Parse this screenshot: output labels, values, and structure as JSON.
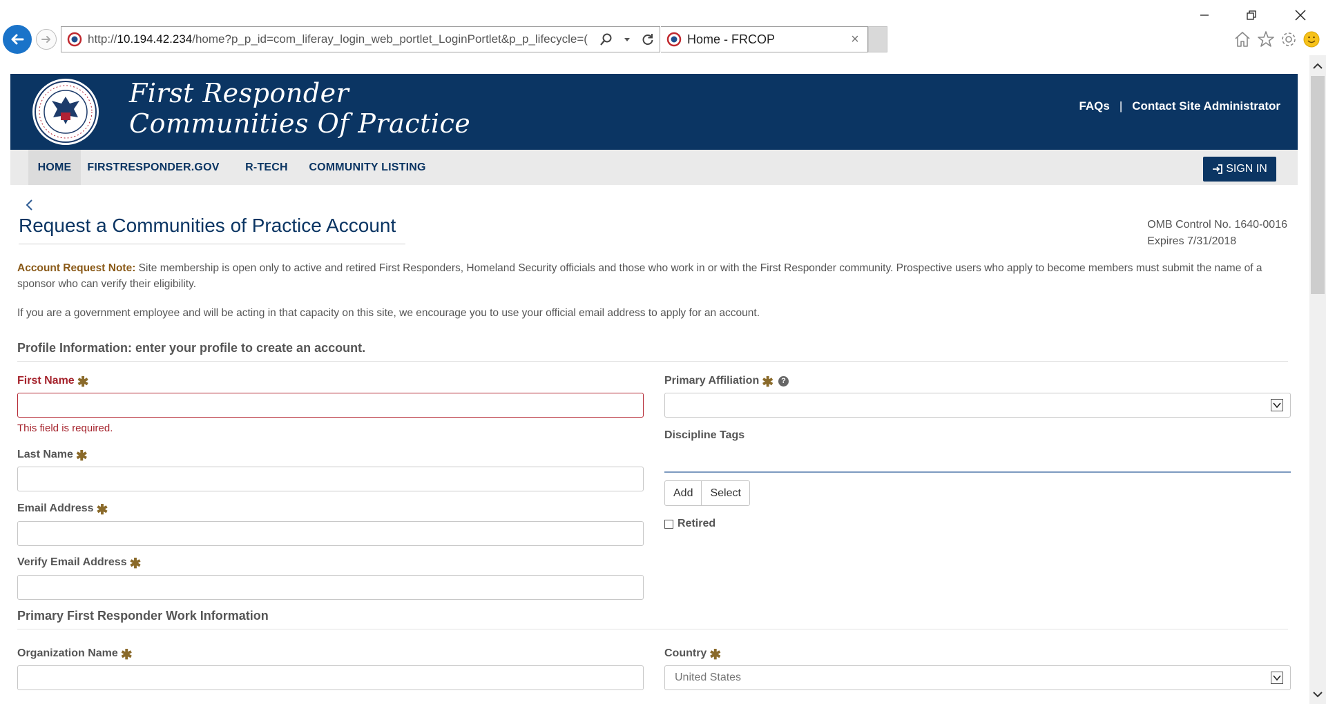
{
  "browser": {
    "url_scheme": "http://",
    "url_host": "10.194.42.234",
    "url_path": "/home?p_p_id=com_liferay_login_web_portlet_LoginPortlet&p_p_lifecycle=(",
    "tab_title": "Home - FRCOP",
    "tab_close": "×"
  },
  "header": {
    "title_line1": "First Responder",
    "title_line2": "Communities Of Practice",
    "faqs": "FAQs",
    "separator": "|",
    "contact": "Contact Site Administrator"
  },
  "nav": {
    "items": [
      {
        "label": "HOME"
      },
      {
        "label": "FIRSTRESPONDER.GOV"
      },
      {
        "label": "R-TECH"
      },
      {
        "label": "COMMUNITY LISTING"
      }
    ],
    "signin": "SIGN IN"
  },
  "page": {
    "title": "Request a Communities of Practice Account",
    "omb_line1": "OMB Control No. 1640-0016",
    "omb_line2": "Expires 7/31/2018",
    "note_label": "Account Request Note:",
    "note_text": " Site membership is open only to active and retired First Responders, Homeland Security officials and those who work in or with the First Responder community. Prospective users who apply to become members must submit the name of a sponsor who can verify their eligibility.",
    "gov_note": "If you are a government employee and will be acting in that capacity on this site, we encourage you to use your official email address to apply for an account."
  },
  "profile": {
    "section_title": "Profile Information: enter your profile to create an account.",
    "first_name_label": "First Name",
    "first_name_error": "This field is required.",
    "last_name_label": "Last Name",
    "email_label": "Email Address",
    "verify_email_label": "Verify Email Address",
    "primary_affiliation_label": "Primary Affiliation",
    "primary_affiliation_value": "",
    "discipline_tags_label": "Discipline Tags",
    "add_label": "Add",
    "select_label": "Select",
    "retired_label": "Retired"
  },
  "work": {
    "section_title": "Primary First Responder Work Information",
    "organization_label": "Organization Name",
    "country_label": "Country",
    "country_value": "United States"
  },
  "required_marker": "✱",
  "help_marker": "?",
  "colors": {
    "brand_navy": "#0b3563",
    "error_red": "#a5232c",
    "note_brown": "#8a5a18"
  }
}
